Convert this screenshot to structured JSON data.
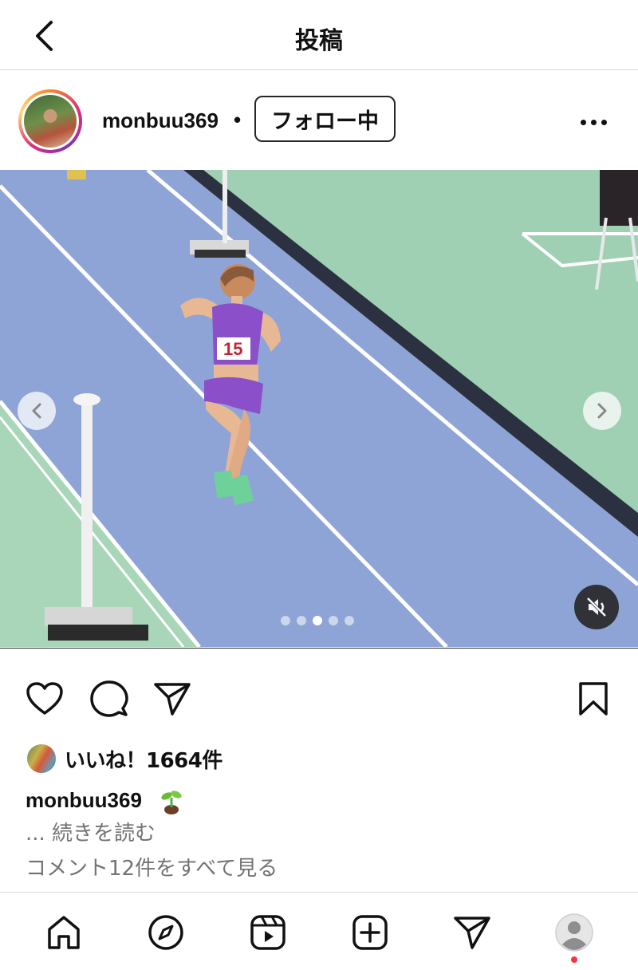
{
  "header": {
    "title": "投稿",
    "back_icon": "chevron-left-icon"
  },
  "post": {
    "username": "monbuu369",
    "separator": "•",
    "follow_label": "フォロー中",
    "more_icon": "more-horizontal-icon"
  },
  "media": {
    "bib_number": "15",
    "carousel_total": 5,
    "carousel_active_index": 2,
    "mute_icon": "speaker-muted-icon",
    "prev_icon": "chevron-left-icon",
    "next_icon": "chevron-right-icon"
  },
  "actions": {
    "like_icon": "heart-icon",
    "comment_icon": "comment-icon",
    "share_icon": "paper-plane-icon",
    "save_icon": "bookmark-icon"
  },
  "likes": {
    "text": "いいね！1664件"
  },
  "caption": {
    "username": "monbuu369",
    "emoji": "seedling-emoji",
    "read_more": "... 続きを読む"
  },
  "comments": {
    "view_all": "コメント12件をすべて見る"
  },
  "bottom_nav": {
    "items": [
      "home-icon",
      "explore-icon",
      "reels-icon",
      "create-icon",
      "direct-icon",
      "profile-icon"
    ],
    "notification_color": "#ff3040"
  },
  "colors": {
    "track": "#8ea4d6",
    "infield": "#9fd0b4",
    "uniform": "#8a4fc9",
    "border": "#dbdbdb",
    "secondary_text": "#737373"
  }
}
